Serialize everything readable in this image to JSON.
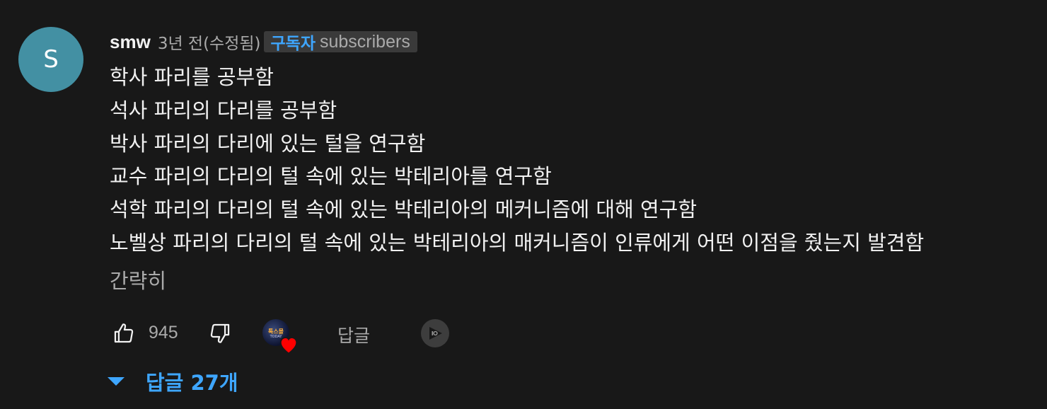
{
  "comment": {
    "avatar_initial": "S",
    "avatar_color": "#4390a3",
    "author": "smw",
    "time": "3년 전(수정됨)",
    "badge": {
      "label_ko": "구독자",
      "label_en": "subscribers"
    },
    "lines": [
      "학사 파리를 공부함",
      "석사 파리의 다리를 공부함",
      "박사 파리의 다리에 있는 털을 연구함",
      "교수 파리의 다리의 털 속에 있는 박테리아를 연구함",
      "석학 파리의 다리의 털 속에 있는 박테리아의 메커니즘에 대해 연구함",
      "노벨상 파리의 다리의 털 속에 있는 박테리아의 매커니즘이 인류에게 어떤 이점을 줬는지 발견함"
    ],
    "collapse_label": "간략히"
  },
  "actions": {
    "like_icon": "thumbs-up-icon",
    "like_count": "945",
    "dislike_icon": "thumbs-down-icon",
    "creator_heart_icon": "creator-heart-icon",
    "creator_avatar_text": "톡스몰",
    "creator_avatar_subtext": "TODAY",
    "reply_label": "답글",
    "ai_icon": "ai-summary-icon"
  },
  "replies": {
    "toggle_label": "답글 27개",
    "accent_color": "#3ea6ff"
  }
}
